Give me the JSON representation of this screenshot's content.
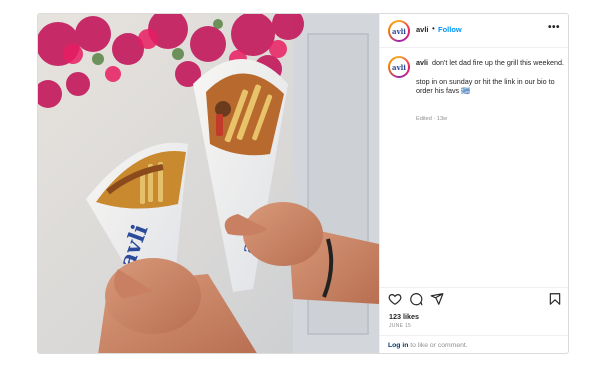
{
  "post": {
    "username": "avli",
    "separator": "•",
    "follow_label": "Follow",
    "more_label": "•••",
    "avatar_text": "avli",
    "wrap_brand": "avli",
    "caption_line1": "don't let dad fire up the grill this weekend.",
    "caption_line2": "stop in on sunday or hit the link in our bio to order his favs 🇬🇷",
    "meta": "Edited · 13w",
    "likes": "123 likes",
    "date": "JUNE 15",
    "login_link": "Log in",
    "login_suffix": " to like or comment."
  },
  "icons": [
    "heart-icon",
    "comment-icon",
    "share-icon",
    "bookmark-icon"
  ],
  "colors": {
    "link": "#0095f6",
    "login": "#00376b",
    "brand_blue": "#2b4a9a",
    "border": "#dbdbdb"
  }
}
